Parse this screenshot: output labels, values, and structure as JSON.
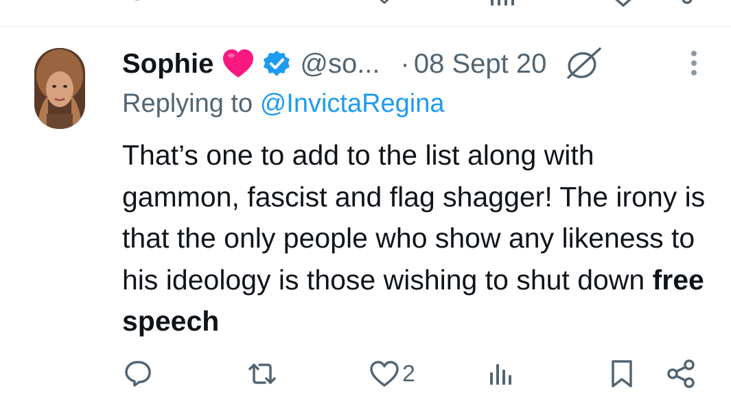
{
  "previous_tweet_actions": {
    "icons": [
      "reply-icon",
      "retweet-icon",
      "views-icon",
      "bookmark-icon",
      "share-icon"
    ]
  },
  "tweet": {
    "display_name": "Sophie",
    "name_emoji": "heart-icon",
    "verified": true,
    "handle": "@so...",
    "separator": "·",
    "timestamp": "08 Sept 20",
    "replying_prefix": "Replying to",
    "replying_to": "@InvictaRegina",
    "text_main": "That’s one to add to the list along with gammon, fascist and flag shagger! The irony is that the only people who show any likeness to his ideology is those wishing to shut down",
    "text_bold": "free speech"
  },
  "actions": {
    "reply_icon": "reply-icon",
    "retweet_icon": "retweet-icon",
    "like_icon": "heart-outline-icon",
    "like_count": "2",
    "views_icon": "views-icon",
    "bookmark_icon": "bookmark-icon",
    "share_icon": "share-icon"
  },
  "colors": {
    "text_primary": "#0f1419",
    "text_secondary": "#536471",
    "link": "#1d9bf0",
    "heart": "#f91880",
    "verified": "#1d9bf0",
    "divider": "#e6ecf0"
  }
}
